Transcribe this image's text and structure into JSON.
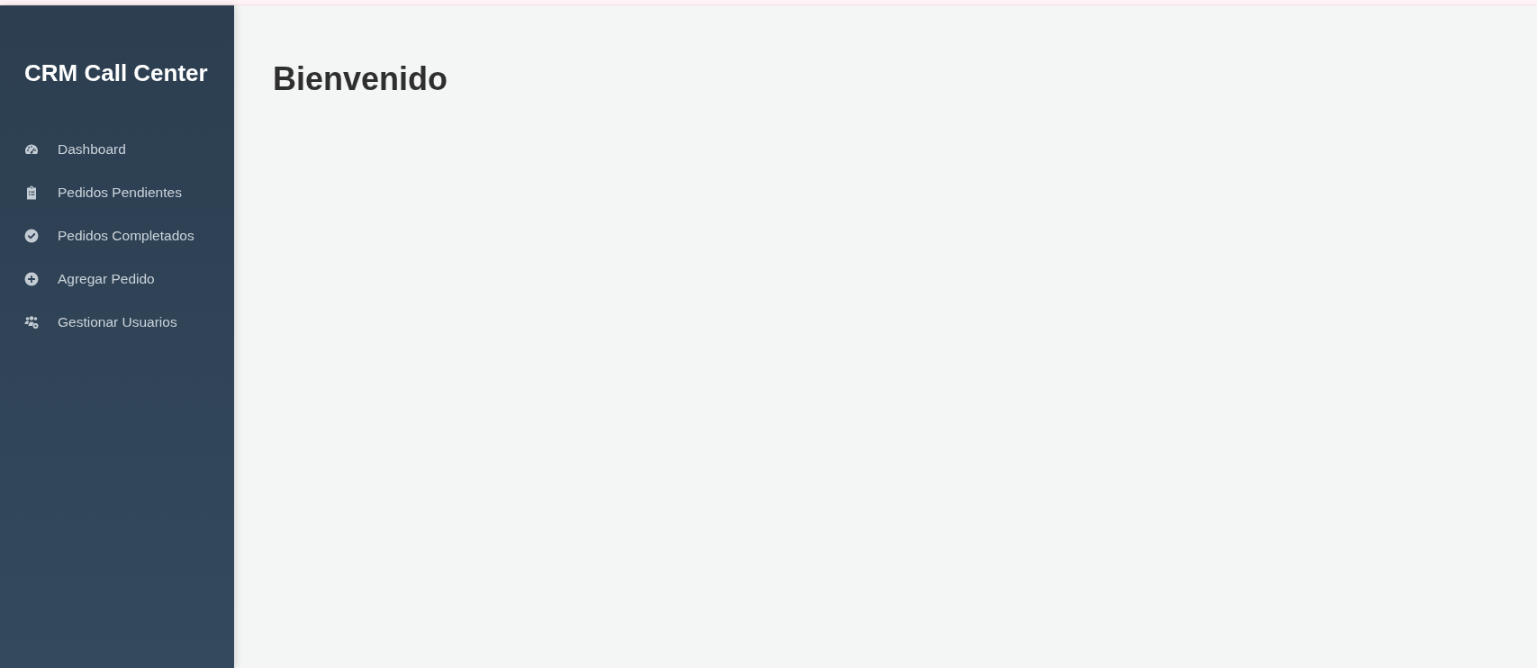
{
  "sidebar": {
    "title": "CRM Call Center",
    "items": [
      {
        "label": "Dashboard",
        "kind": "gauge"
      },
      {
        "label": "Pedidos Pendientes",
        "kind": "clipboard"
      },
      {
        "label": "Pedidos Completados",
        "kind": "check"
      },
      {
        "label": "Agregar Pedido",
        "kind": "plus"
      },
      {
        "label": "Gestionar Usuarios",
        "kind": "users"
      }
    ]
  },
  "main": {
    "heading": "Bienvenido"
  }
}
